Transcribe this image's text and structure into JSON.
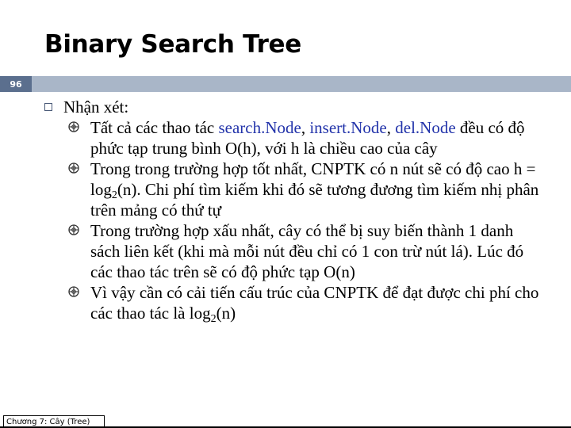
{
  "slide": {
    "title": "Binary Search Tree",
    "page_number": "96",
    "footer": "Chương 7: Cây (Tree)"
  },
  "content": {
    "heading": "Nhận xét:",
    "bullets": [
      {
        "p1": "Tất cả các thao tác ",
        "k1": "search.Node",
        "s1": ", ",
        "k2": "insert.Node",
        "s2": ", ",
        "k3": "del.Node",
        "p2": " đều có độ phức tạp trung bình O(h), với h là chiều cao của cây"
      },
      {
        "p1": "Trong trong trường hợp tốt nhất, CNPTK có n nút sẽ có độ cao h = log",
        "sub": "2",
        "p2": "(n). Chi phí tìm kiếm khi đó sẽ tương đương tìm kiếm nhị phân trên mảng có thứ tự"
      },
      {
        "p1": "Trong trường hợp xấu nhất, cây có thể bị suy biến thành 1 danh sách liên kết (khi mà mỗi nút đều chỉ có 1 con trừ nút lá). Lúc đó các thao tác trên sẽ có độ phức tạp O(n)"
      },
      {
        "p1": "Vì vậy cần có cải tiến cấu trúc của CNPTK để đạt được chi phí cho các thao tác là log",
        "sub": "2",
        "p2": "(n)"
      }
    ]
  },
  "colors": {
    "header_band": "#a9b6c8",
    "page_badge": "#5b6f8e",
    "keyword": "#2233aa"
  },
  "icons": {
    "level1_bullet": "hollow-square-icon",
    "level2_bullet": "target-circle-icon"
  }
}
